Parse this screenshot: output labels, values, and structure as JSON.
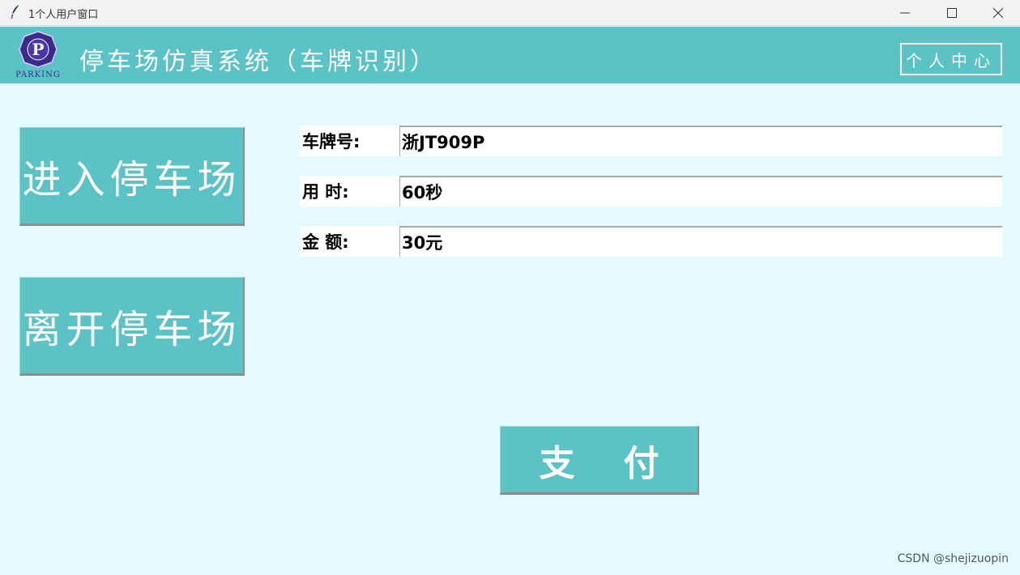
{
  "window": {
    "title": "1个人用户窗口",
    "icon": "feather-icon"
  },
  "header": {
    "logo_letter": "P",
    "logo_text": "PARKING",
    "title": "停车场仿真系统（车牌识别）",
    "profile_label": "个人中心"
  },
  "actions": {
    "enter_label": "进入停车场",
    "leave_label": "离开停车场",
    "pay_label": "支付"
  },
  "info": {
    "plate_label": "车牌号:",
    "plate_value": "浙JT909P",
    "time_label": "用  时:",
    "time_value": "60秒",
    "amount_label": "金  额:",
    "amount_value": "30元"
  },
  "watermark": "CSDN @shejizuopin",
  "colors": {
    "background": "#e3fbff",
    "header": "#5bc3c6",
    "button": "#5bc3c6",
    "logo": "#3a2a8a"
  }
}
